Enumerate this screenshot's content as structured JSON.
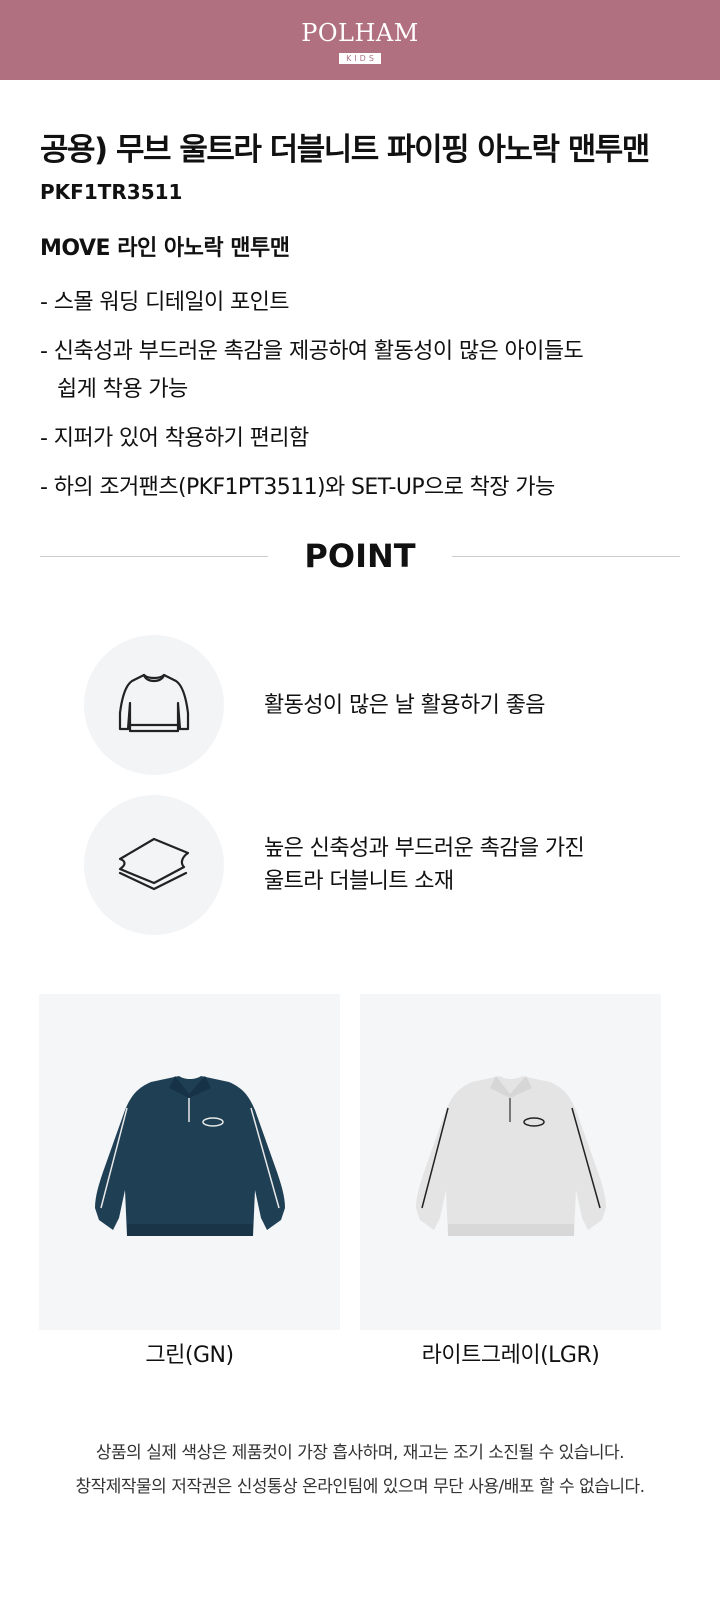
{
  "brand": {
    "name": "POLHAM",
    "sub": "KIDS",
    "color": "#b07080"
  },
  "product": {
    "title": "공용) 무브 울트라 더블니트 파이핑 아노락 맨투맨",
    "code": "PKF1TR3511",
    "subtitle": "MOVE 라인 아노락 맨투맨",
    "features": [
      "- 스몰 워딩 디테일이 포인트",
      "- 신축성과 부드러운 촉감을 제공하여 활동성이 많은 아이들도",
      "쉽게 착용 가능",
      "- 지퍼가 있어 착용하기 편리함",
      "- 하의 조거팬츠(PKF1PT3511)와 SET-UP으로 착장 가능"
    ]
  },
  "point": {
    "heading": "POINT",
    "items": [
      {
        "icon": "sweatshirt-icon",
        "text": "활동성이 많은 날 활용하기 좋음"
      },
      {
        "icon": "fabric-layers-icon",
        "line1": "높은 신축성과 부드러운 촉감을 가진",
        "line2": "울트라 더블니트 소재"
      }
    ]
  },
  "colors": [
    {
      "label": "그린(GN)",
      "swatch": "#1f3f55"
    },
    {
      "label": "라이트그레이(LGR)",
      "swatch": "#e4e4e4"
    }
  ],
  "notice": {
    "line1": "상품의 실제 색상은 제품컷이 가장 흡사하며, 재고는 조기 소진될 수 있습니다.",
    "line2": "창작제작물의 저작권은 신성통상 온라인팀에 있으며 무단 사용/배포 할 수 없습니다."
  }
}
